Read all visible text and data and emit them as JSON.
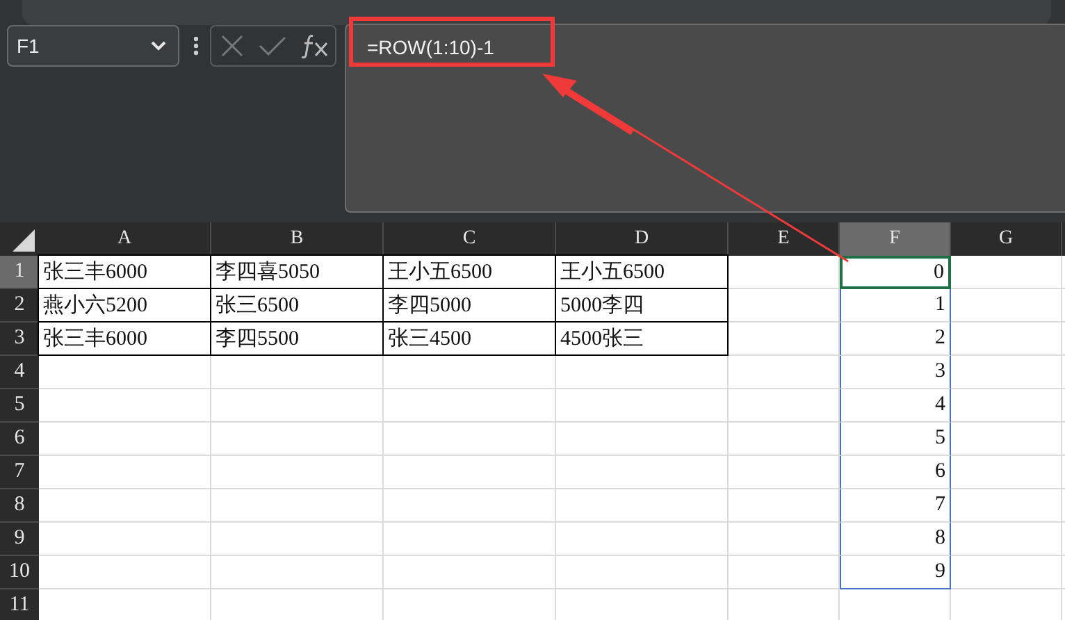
{
  "name_box": {
    "value": "F1"
  },
  "formula_bar": {
    "value": "=ROW(1:10)-1"
  },
  "columns": [
    {
      "label": "A",
      "selected": false
    },
    {
      "label": "B",
      "selected": false
    },
    {
      "label": "C",
      "selected": false
    },
    {
      "label": "D",
      "selected": false
    },
    {
      "label": "E",
      "selected": false
    },
    {
      "label": "F",
      "selected": true
    },
    {
      "label": "G",
      "selected": false
    }
  ],
  "rows": [
    {
      "label": "1",
      "selected": true,
      "cells": [
        {
          "kind": "text",
          "text": "张三丰6000"
        },
        {
          "kind": "text",
          "text": "李四喜5050"
        },
        {
          "kind": "text",
          "text": "王小五6500"
        },
        {
          "kind": "text",
          "text": "王小五6500"
        },
        null,
        {
          "kind": "number",
          "text": "0"
        },
        null
      ]
    },
    {
      "label": "2",
      "selected": false,
      "cells": [
        {
          "kind": "text",
          "text": "燕小六5200"
        },
        {
          "kind": "text",
          "text": "张三6500"
        },
        {
          "kind": "text",
          "text": "李四5000"
        },
        {
          "kind": "text",
          "text": "5000李四"
        },
        null,
        {
          "kind": "number",
          "text": "1"
        },
        null
      ]
    },
    {
      "label": "3",
      "selected": false,
      "cells": [
        {
          "kind": "text",
          "text": "张三丰6000"
        },
        {
          "kind": "text",
          "text": "李四5500"
        },
        {
          "kind": "text",
          "text": "张三4500"
        },
        {
          "kind": "text",
          "text": "4500张三"
        },
        null,
        {
          "kind": "number",
          "text": "2"
        },
        null
      ]
    },
    {
      "label": "4",
      "selected": false,
      "cells": [
        null,
        null,
        null,
        null,
        null,
        {
          "kind": "number",
          "text": "3"
        },
        null
      ]
    },
    {
      "label": "5",
      "selected": false,
      "cells": [
        null,
        null,
        null,
        null,
        null,
        {
          "kind": "number",
          "text": "4"
        },
        null
      ]
    },
    {
      "label": "6",
      "selected": false,
      "cells": [
        null,
        null,
        null,
        null,
        null,
        {
          "kind": "number",
          "text": "5"
        },
        null
      ]
    },
    {
      "label": "7",
      "selected": false,
      "cells": [
        null,
        null,
        null,
        null,
        null,
        {
          "kind": "number",
          "text": "6"
        },
        null
      ]
    },
    {
      "label": "8",
      "selected": false,
      "cells": [
        null,
        null,
        null,
        null,
        null,
        {
          "kind": "number",
          "text": "7"
        },
        null
      ]
    },
    {
      "label": "9",
      "selected": false,
      "cells": [
        null,
        null,
        null,
        null,
        null,
        {
          "kind": "number",
          "text": "8"
        },
        null
      ]
    },
    {
      "label": "10",
      "selected": false,
      "cells": [
        null,
        null,
        null,
        null,
        null,
        {
          "kind": "number",
          "text": "9"
        },
        null
      ]
    },
    {
      "label": "11",
      "selected": false,
      "cells": [
        null,
        null,
        null,
        null,
        null,
        null,
        null
      ]
    }
  ]
}
